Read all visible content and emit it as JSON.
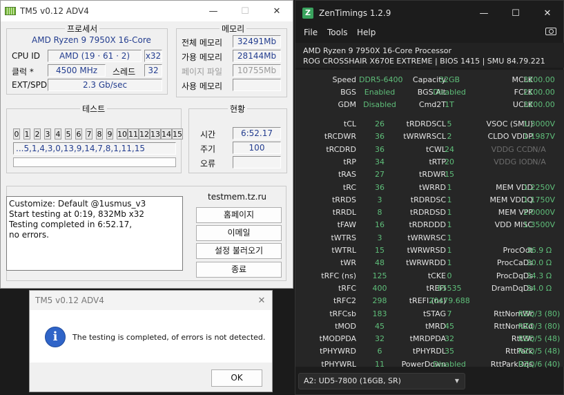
{
  "tm5": {
    "title": "TM5 v0.12 ADV4",
    "min": "—",
    "max": "☐",
    "close": "✕",
    "processor": {
      "heading": "프로세서",
      "name": "AMD Ryzen 9 7950X 16-Core",
      "cpuid_label": "CPU ID",
      "cpuid": "AMD  (19 · 61 · 2)",
      "cpuid_threads": "x32",
      "clock_label": "클럭 *",
      "clock": "4500 MHz",
      "threads_label": "스레드",
      "threads": "32",
      "ext_label": "EXT/SPD",
      "ext": "2.3 Gb/sec"
    },
    "memory": {
      "heading": "메모리",
      "total_label": "전체 메모리",
      "total": "32491Mb",
      "avail_label": "가용 메모리",
      "avail": "28144Mb",
      "page_label": "페이지 파일",
      "page": "10755Mb",
      "used_label": "사용 메모리",
      "used": ""
    },
    "test": {
      "heading": "테스트",
      "cores": [
        "0",
        "1",
        "2",
        "3",
        "4",
        "5",
        "6",
        "7",
        "8",
        "9",
        "10",
        "11",
        "12",
        "13",
        "14",
        "15"
      ],
      "sequence": "...5,1,4,3,0,13,9,14,7,8,1,11,15"
    },
    "status": {
      "heading": "현황",
      "time_label": "시간",
      "time": "6:52.17",
      "cycle_label": "주기",
      "cycle": "100",
      "error_label": "오류",
      "error": ""
    },
    "log": [
      "Customize: Default @1usmus_v3",
      "Start testing at 0:19, 832Mb x32",
      "Testing completed in 6:52.17,",
      "no errors."
    ],
    "site": "testmem.tz.ru",
    "buttons": {
      "home": "홈페이지",
      "email": "이메일",
      "load": "설정 불러오기",
      "exit": "종료"
    }
  },
  "dialog": {
    "title": "TM5 v0.12 ADV4",
    "close": "✕",
    "icon": "i",
    "message": "The testing is completed, of errors is not detected.",
    "ok": "OK"
  },
  "zen": {
    "title": "ZenTimings 1.2.9",
    "min": "—",
    "max": "☐",
    "close": "✕",
    "logo": "Z",
    "menu": {
      "file": "File",
      "tools": "Tools",
      "help": "Help"
    },
    "sys1": "AMD Ryzen 9 7950X 16-Core Processor",
    "sys2": "ROG CROSSHAIR X670E EXTREME | BIOS 1415 | SMU 84.79.221",
    "top_rows": [
      {
        "a": "Speed",
        "av": "DDR5-6400",
        "b": "Capacity",
        "bv": "32GB",
        "c": "MCLK",
        "cv": "3200.00"
      },
      {
        "a": "BGS",
        "av": "Enabled",
        "b": "BGS Alt",
        "bv": "Disabled",
        "c": "FCLK",
        "cv": "2100.00"
      },
      {
        "a": "GDM",
        "av": "Disabled",
        "b": "Cmd2T",
        "bv": "1T",
        "c": "UCLK",
        "cv": "3200.00"
      }
    ],
    "rows": [
      {
        "a": "tCL",
        "av": "26",
        "b": "tRDRDSCL",
        "bv": "5",
        "c": "VSOC (SMU)",
        "cv": "1.3000V",
        "cdim": false
      },
      {
        "a": "tRCDWR",
        "av": "36",
        "b": "tWRWRSCL",
        "bv": "2",
        "c": "CLDO VDDP",
        "cv": "1.1987V",
        "cdim": false
      },
      {
        "a": "tRCDRD",
        "av": "36",
        "b": "tCWL",
        "bv": "24",
        "c": "VDDG CCD",
        "cv": "N/A",
        "cdim": true
      },
      {
        "a": "tRP",
        "av": "34",
        "b": "tRTP",
        "bv": "20",
        "c": "VDDG IOD",
        "cv": "N/A",
        "cdim": true
      },
      {
        "a": "tRAS",
        "av": "27",
        "b": "tRDWR",
        "bv": "15",
        "c": "",
        "cv": "",
        "cdim": false
      },
      {
        "a": "tRC",
        "av": "36",
        "b": "tWRRD",
        "bv": "1",
        "c": "MEM VDD",
        "cv": "1.2250V",
        "cdim": false
      },
      {
        "a": "tRRDS",
        "av": "3",
        "b": "tRDRDSC",
        "bv": "1",
        "c": "MEM VDDQ",
        "cv": "1.1750V",
        "cdim": false
      },
      {
        "a": "tRRDL",
        "av": "8",
        "b": "tRDRDSD",
        "bv": "1",
        "c": "MEM VPP",
        "cv": "2.0000V",
        "cdim": false
      },
      {
        "a": "tFAW",
        "av": "16",
        "b": "tRDRDDD",
        "bv": "1",
        "c": "VDD MISC",
        "cv": "1.3500V",
        "cdim": false
      },
      {
        "a": "tWTRS",
        "av": "3",
        "b": "tWRWRSC",
        "bv": "1",
        "c": "",
        "cv": "",
        "cdim": false
      },
      {
        "a": "tWTRL",
        "av": "15",
        "b": "tWRWRSD",
        "bv": "1",
        "c": "ProcOdt",
        "cv": "36.9 Ω",
        "cdim": false
      },
      {
        "a": "tWR",
        "av": "48",
        "b": "tWRWRDD",
        "bv": "1",
        "c": "ProcCaDs",
        "cv": "30.0 Ω",
        "cdim": false
      },
      {
        "a": "tRFC (ns)",
        "av": "125",
        "b": "tCKE",
        "bv": "0",
        "c": "ProcDqDs",
        "cv": "34.3 Ω",
        "cdim": false
      },
      {
        "a": "tRFC",
        "av": "400",
        "b": "tREFI",
        "bv": "65535",
        "c": "DramDqDs",
        "cv": "34.0 Ω",
        "cdim": false
      },
      {
        "a": "tRFC2",
        "av": "298",
        "b": "tREFI (ns)",
        "bv": "20479.688",
        "c": "",
        "cv": "",
        "cdim": false
      },
      {
        "a": "tRFCsb",
        "av": "183",
        "b": "tSTAG",
        "bv": "7",
        "c": "RttNomWr",
        "cv": "RZQ/3 (80)",
        "cdim": false
      },
      {
        "a": "tMOD",
        "av": "45",
        "b": "tMRD",
        "bv": "45",
        "c": "RttNomRd",
        "cv": "RZQ/3 (80)",
        "cdim": false
      },
      {
        "a": "tMODPDA",
        "av": "32",
        "b": "tMRDPDA",
        "bv": "32",
        "c": "RttWr",
        "cv": "RZQ/5 (48)",
        "cdim": false
      },
      {
        "a": "tPHYWRD",
        "av": "6",
        "b": "tPHYRDL",
        "bv": "35",
        "c": "RttPark",
        "cv": "RZQ/5 (48)",
        "cdim": false
      },
      {
        "a": "tPHYWRL",
        "av": "11",
        "b": "PowerDown",
        "bv": "Disabled",
        "c": "RttParkDqs",
        "cv": "RZQ/6 (40)",
        "cdim": false
      }
    ],
    "dimm": "A2: UD5-7800 (16GB, SR)",
    "dimm_caret": "▼"
  }
}
